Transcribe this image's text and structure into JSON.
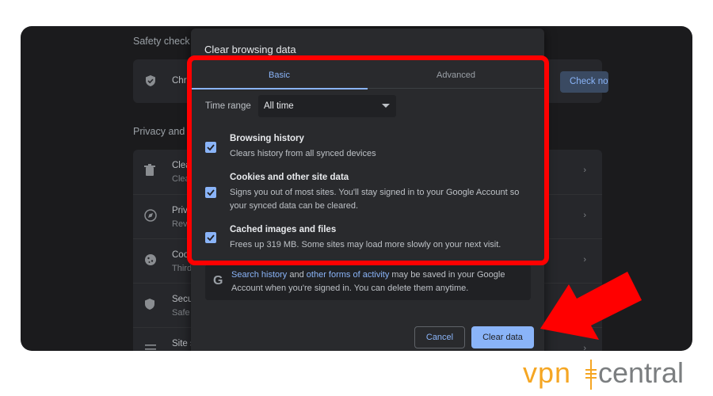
{
  "background": {
    "safety_check_heading": "Safety check",
    "safety_row_text": "Chr",
    "check_now_label": "Check now",
    "privacy_heading": "Privacy and",
    "rows": [
      {
        "icon": "trash-icon",
        "title": "Clea",
        "sub": "Clea"
      },
      {
        "icon": "compass-icon",
        "title": "Priv",
        "sub": "Rev"
      },
      {
        "icon": "cookie-icon",
        "title": "Coo",
        "sub": "Third"
      },
      {
        "icon": "shield-icon",
        "title": "Secu",
        "sub": "Safe"
      },
      {
        "icon": "settings-icon",
        "title": "Site s",
        "sub": ""
      }
    ]
  },
  "dialog": {
    "title": "Clear browsing data",
    "tabs": {
      "basic": "Basic",
      "advanced": "Advanced"
    },
    "time_range": {
      "label": "Time range",
      "value": "All time"
    },
    "options": [
      {
        "title": "Browsing history",
        "description": "Clears history from all synced devices",
        "checked": true
      },
      {
        "title": "Cookies and other site data",
        "description": "Signs you out of most sites. You'll stay signed in to your Google Account so your synced data can be cleared.",
        "checked": true
      },
      {
        "title": "Cached images and files",
        "description": "Frees up 319 MB. Some sites may load more slowly on your next visit.",
        "checked": true
      }
    ],
    "info": {
      "icon": "google-g-icon",
      "link1": "Search history",
      "and": " and ",
      "link2": "other forms of activity",
      "rest": " may be saved in your Google Account when you're signed in. You can delete them anytime."
    },
    "cancel_label": "Cancel",
    "clear_label": "Clear data"
  },
  "logo": {
    "part1": "vpn",
    "part2": "central"
  },
  "colors": {
    "accent": "#8ab4f8",
    "annotation": "#ff0000",
    "logo_orange": "#f5a623",
    "logo_gray": "#7b7e80"
  }
}
